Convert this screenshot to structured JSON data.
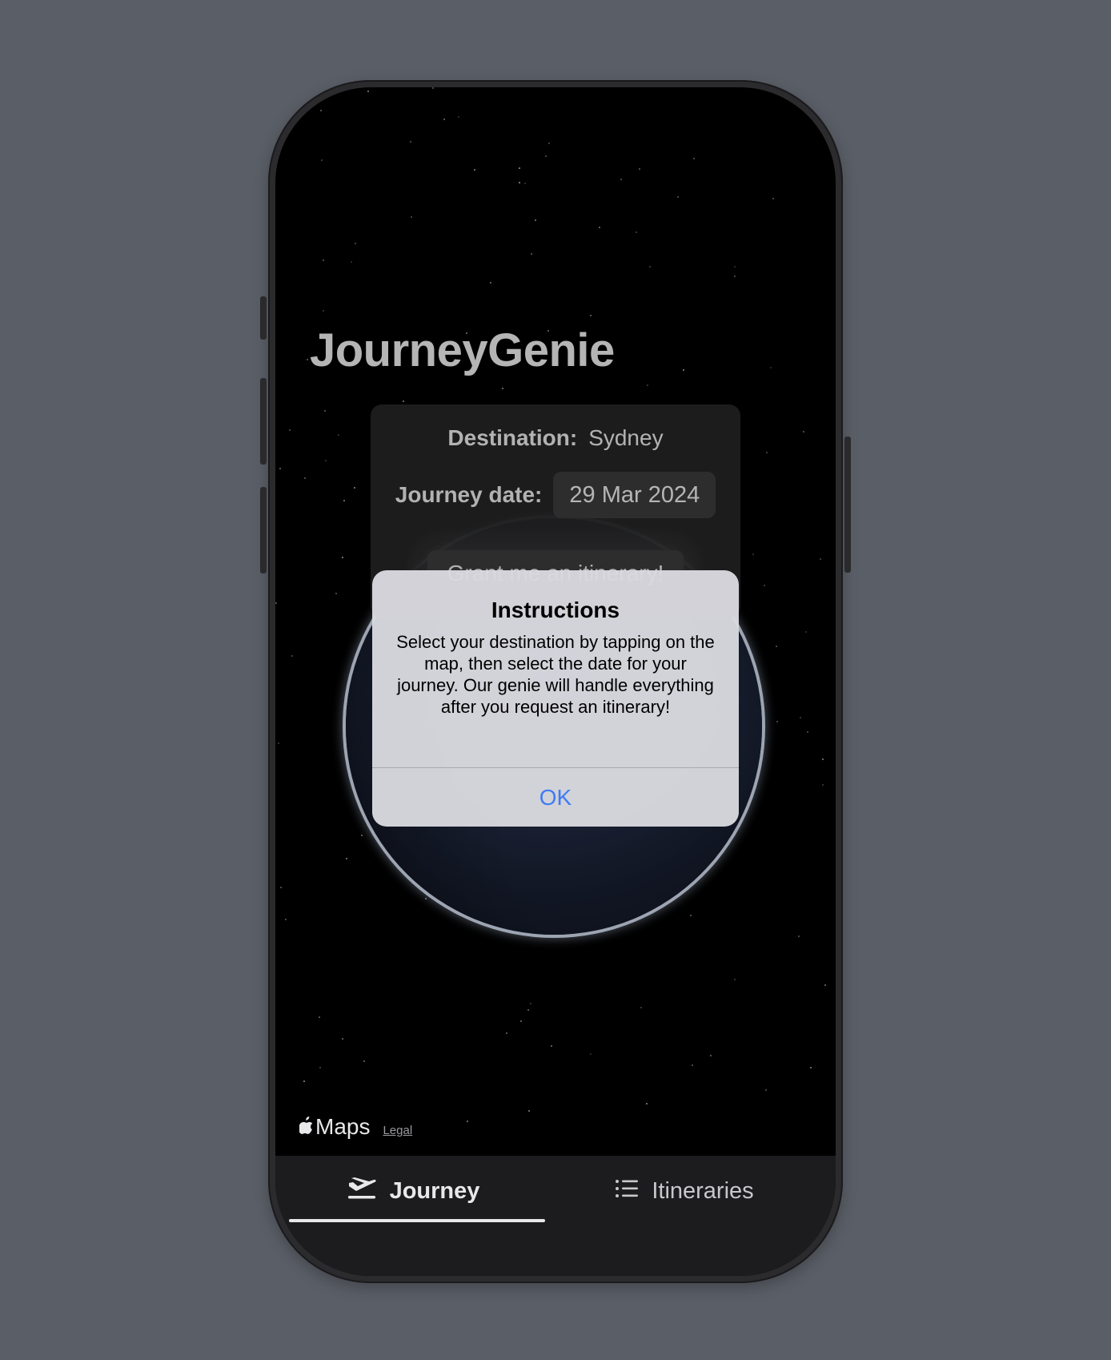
{
  "app": {
    "title": "JourneyGenie"
  },
  "form": {
    "destination_label": "Destination:",
    "destination_value": "Sydney",
    "date_label": "Journey date:",
    "date_value": "29 Mar 2024",
    "grant_button": "Grant me an itinerary!"
  },
  "alert": {
    "title": "Instructions",
    "message": "Select your destination by tapping on the map, then select the date for your journey. Our genie will handle everything after you request an itinerary!",
    "ok_label": "OK"
  },
  "map": {
    "attribution_brand": "Maps",
    "legal_link": "Legal"
  },
  "tabbar": {
    "tabs": [
      {
        "label": "Journey",
        "icon": "airplane-departure-icon",
        "selected": true
      },
      {
        "label": "Itineraries",
        "icon": "list-icon",
        "selected": false
      }
    ]
  },
  "colors": {
    "background": "#5a5e66",
    "accent": "#3f7cf1",
    "screen": "#000000"
  }
}
